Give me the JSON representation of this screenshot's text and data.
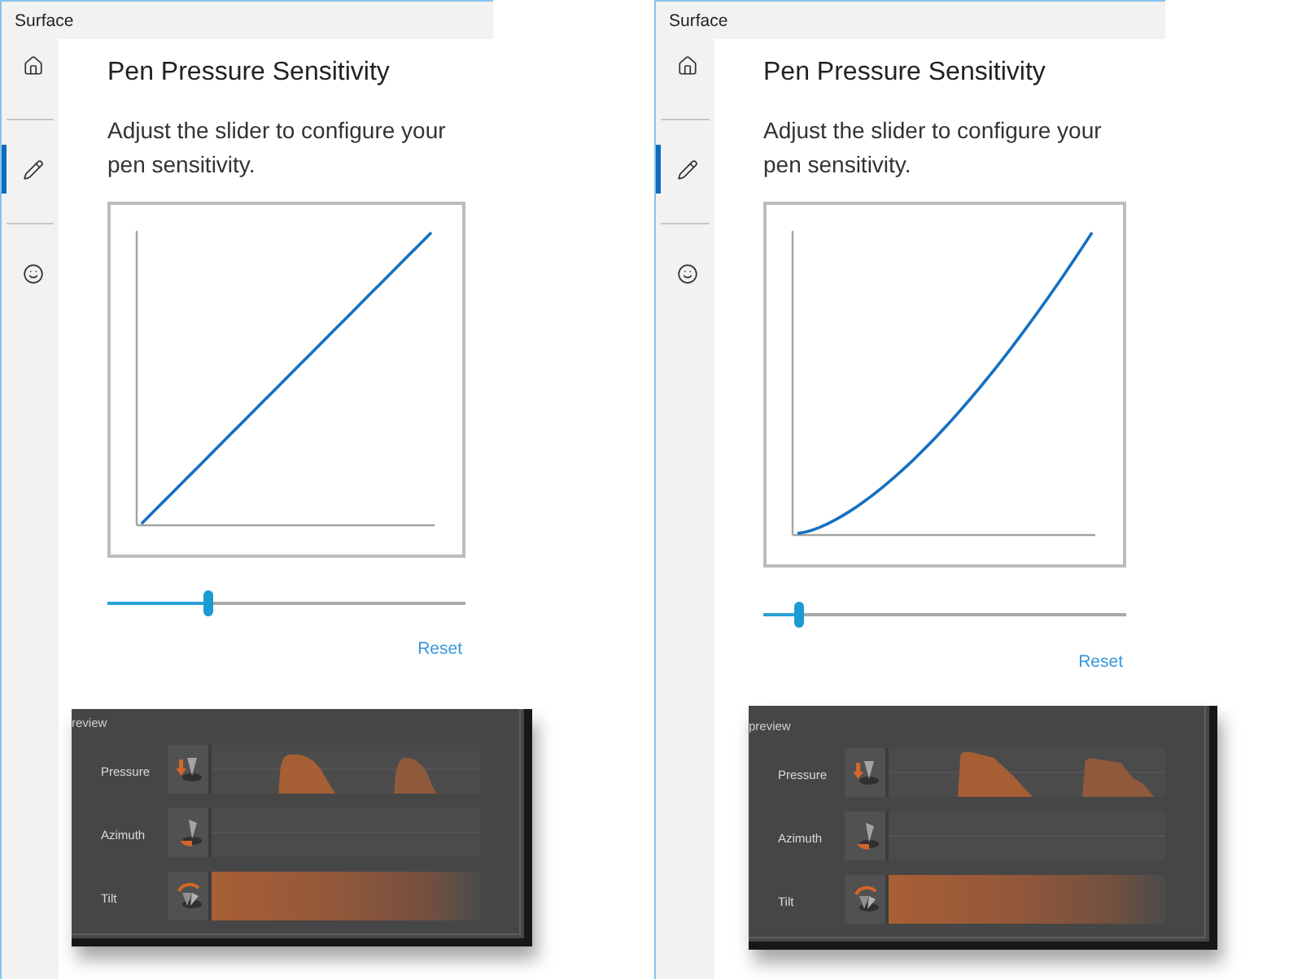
{
  "panels": [
    {
      "window": {
        "title": "Surface"
      },
      "sidebar": {
        "items": [
          {
            "kind": "home",
            "selected": false
          },
          {
            "kind": "pen",
            "selected": true
          },
          {
            "kind": "smiley",
            "selected": false
          }
        ]
      },
      "heading": "Pen Pressure Sensitivity",
      "description": "Adjust the slider to configure your pen sensitivity.",
      "slider": {
        "level": 0.28
      },
      "reset_link": "Reset",
      "preview": {
        "heading": "review",
        "rows": [
          {
            "kind": "pressure",
            "label": "Pressure"
          },
          {
            "kind": "azimuth",
            "label": "Azimuth"
          },
          {
            "kind": "tilt",
            "label": "Tilt"
          }
        ]
      }
    },
    {
      "window": {
        "title": "Surface"
      },
      "sidebar": {
        "items": [
          {
            "kind": "home",
            "selected": false
          },
          {
            "kind": "pen",
            "selected": true
          },
          {
            "kind": "smiley",
            "selected": false
          }
        ]
      },
      "heading": "Pen Pressure Sensitivity",
      "description": "Adjust the slider to configure your pen sensitivity.",
      "slider": {
        "level": 0.1
      },
      "reset_link": "Reset",
      "preview": {
        "heading": "preview",
        "rows": [
          {
            "kind": "pressure",
            "label": "Pressure"
          },
          {
            "kind": "azimuth",
            "label": "Azimuth"
          },
          {
            "kind": "tilt",
            "label": "Tilt"
          }
        ]
      }
    }
  ]
}
